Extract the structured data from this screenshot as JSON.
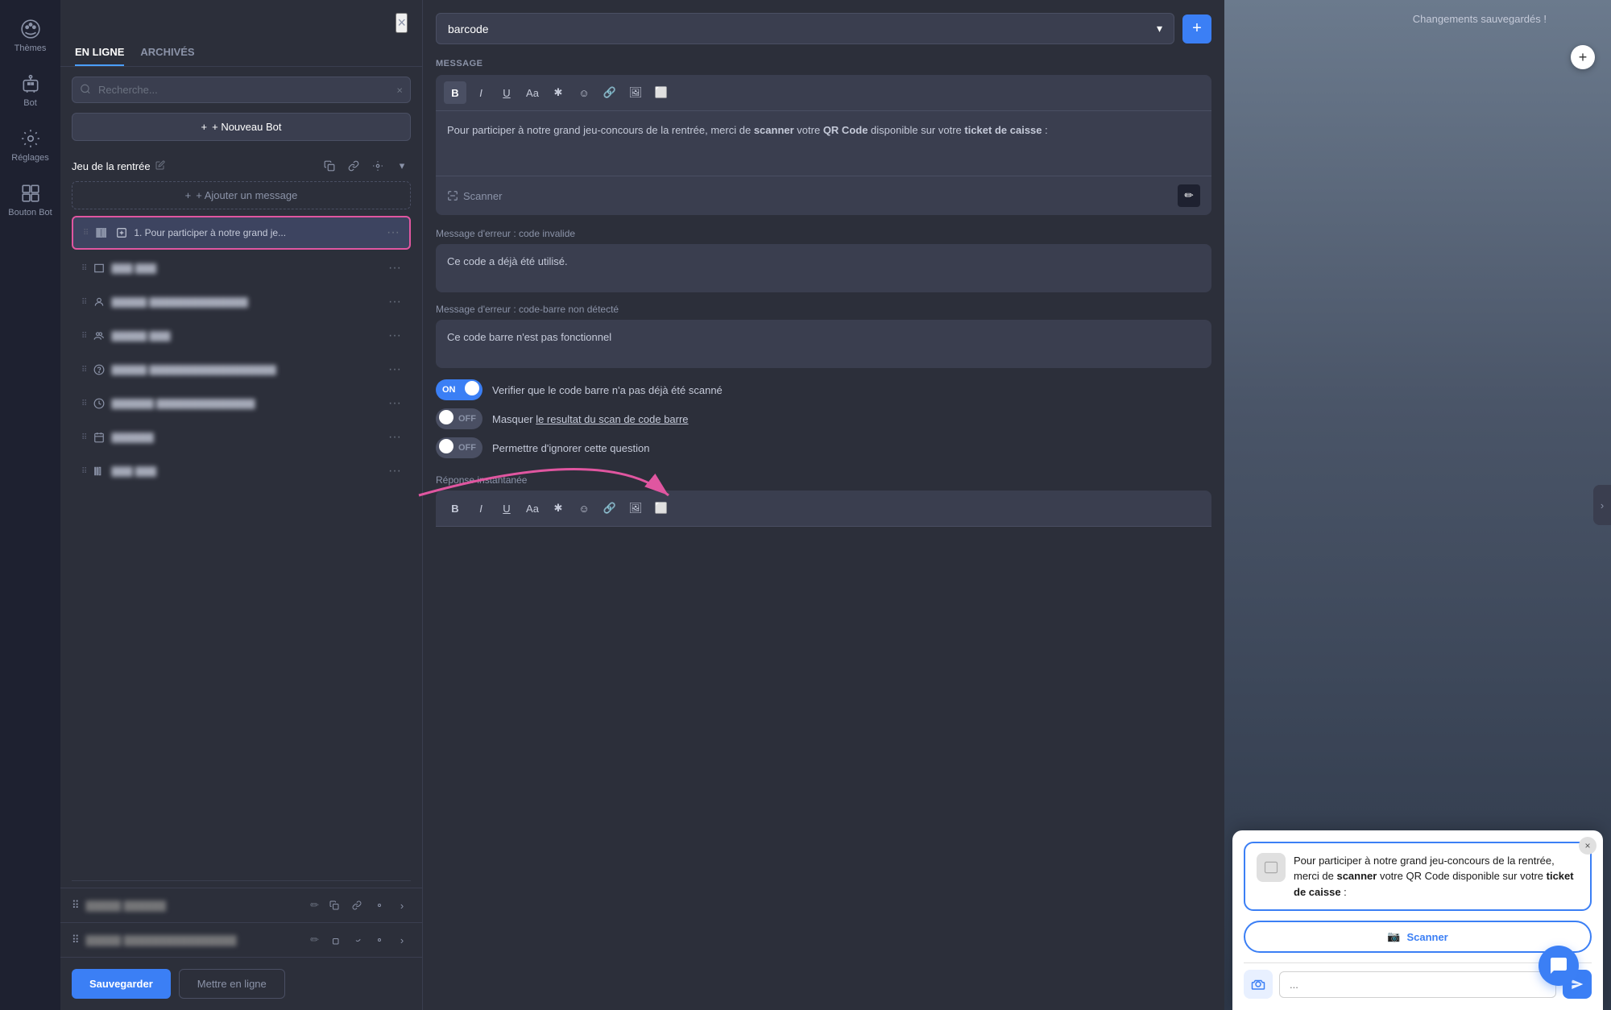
{
  "sidebar": {
    "items": [
      {
        "id": "themes",
        "label": "Thèmes",
        "icon": "palette"
      },
      {
        "id": "bot",
        "label": "Bot",
        "icon": "robot"
      },
      {
        "id": "settings",
        "label": "Réglages",
        "icon": "gear"
      },
      {
        "id": "bouton-bot",
        "label": "Bouton Bot",
        "icon": "grid"
      }
    ]
  },
  "panel": {
    "tab_online": "EN LIGNE",
    "tab_archived": "ARCHIVÉS",
    "search_placeholder": "Recherche...",
    "new_bot_label": "+ Nouveau Bot",
    "section_title": "Jeu de la rentrée",
    "add_message_label": "+ Ajouter un message",
    "active_item": "1. Pour participer à notre grand je...",
    "items": [
      {
        "type": "barcode",
        "text": ""
      },
      {
        "type": "user",
        "text": ""
      },
      {
        "type": "users",
        "text": ""
      },
      {
        "type": "question",
        "text": ""
      },
      {
        "type": "clock",
        "text": ""
      },
      {
        "type": "calendar",
        "text": ""
      },
      {
        "type": "barcode2",
        "text": ""
      }
    ],
    "sub_items": [
      {
        "text": "blurred text 1"
      },
      {
        "text": "blurred text 2"
      }
    ],
    "save_label": "Sauvegarder",
    "publish_label": "Mettre en ligne"
  },
  "main": {
    "barcode_value": "barcode",
    "message_section_label": "MESSAGE",
    "message_text": "Pour participer à notre grand jeu-concours de la rentrée, merci de scanner votre QR Code disponible sur votre ticket de caisse :",
    "message_bold_parts": [
      "scanner",
      "QR Code",
      "ticket de caisse"
    ],
    "scanner_label": "Scanner",
    "error1_label": "Message d'erreur : code invalide",
    "error1_text": "Ce code a déjà été utilisé.",
    "error2_label": "Message d'erreur : code-barre non détecté",
    "error2_text": "Ce code barre n'est pas fonctionnel",
    "toggle1_state": "ON",
    "toggle1_label": "Verifier que le code barre n'a pas déjà été scanné",
    "toggle2_state": "OFF",
    "toggle2_label": "Masquer le resultat du scan de code barre",
    "toggle3_state": "OFF",
    "toggle3_label": "Permettre d'ignorer cette question",
    "reponse_label": "Réponse instantanée",
    "toolbar_buttons": [
      "B",
      "I",
      "U",
      "Aa",
      "✱",
      "☺",
      "🔗",
      "🖼",
      "⬜"
    ]
  },
  "preview": {
    "message_text": "Pour participer à notre grand jeu-concours de la rentrée, merci de ",
    "message_bold1": "scanner",
    "message_mid": " votre QR Code disponible sur votre ",
    "message_bold2": "ticket de caisse",
    "message_end": " :",
    "scanner_btn": "Scanner",
    "input_placeholder": "...",
    "add_btn": "+",
    "close_btn": "×"
  },
  "status": {
    "saved": "Changements sauvegardés !"
  }
}
